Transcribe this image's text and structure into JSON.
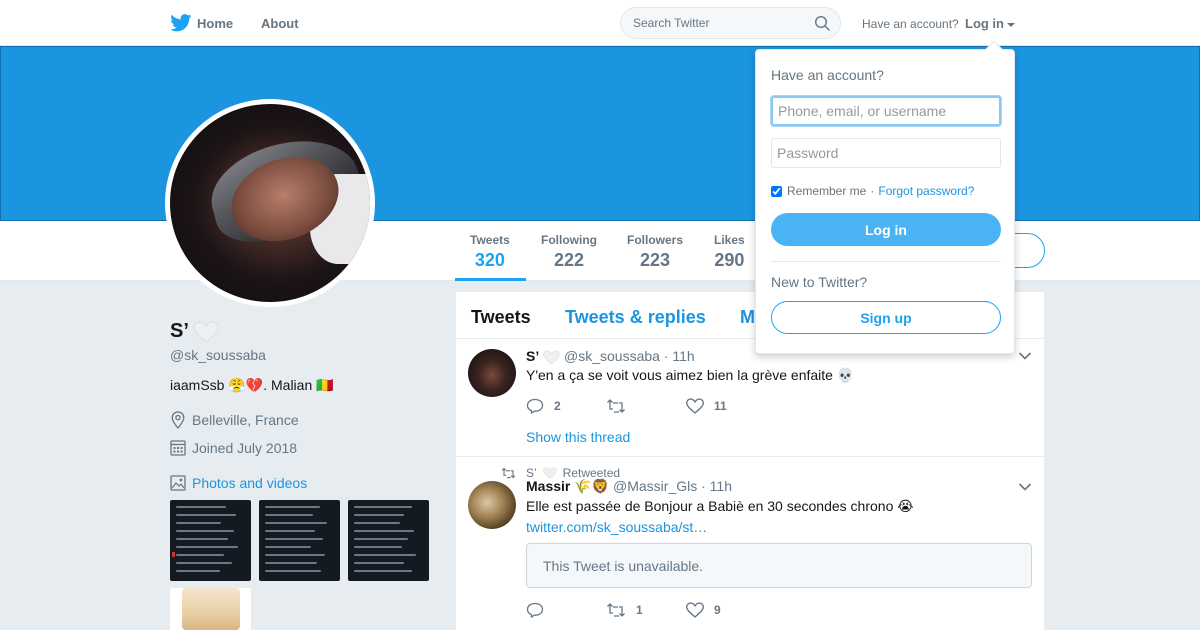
{
  "nav": {
    "home_label": "Home",
    "about_label": "About",
    "search_placeholder": "Search Twitter",
    "have_account_text": "Have an account?",
    "login_label": "Log in"
  },
  "colors": {
    "brand_blue": "#1da1f2",
    "banner_blue": "#1b95e0",
    "link_blue": "#1b95e0"
  },
  "profile_nav": {
    "stats": [
      {
        "label": "Tweets",
        "value": "320"
      },
      {
        "label": "Following",
        "value": "222"
      },
      {
        "label": "Followers",
        "value": "223"
      },
      {
        "label": "Likes",
        "value": "290"
      }
    ],
    "active_stat": "Tweets"
  },
  "profile": {
    "name": "S’",
    "handle": "@sk_soussaba",
    "bio": "iaamSsb 😤💔. Malian 🇲🇱",
    "location": "Belleville, France",
    "joined": "Joined July 2018",
    "photos_link": "Photos and videos"
  },
  "timeline": {
    "tabs": [
      "Tweets",
      "Tweets & replies",
      "M"
    ],
    "tweets": [
      {
        "name": "S’",
        "handle": "@sk_soussaba",
        "time": "· 11h",
        "text": "Y'en a ça se voit vous aimez bien la grève enfaite 💀",
        "replies": "2",
        "retweets": "",
        "likes": "11",
        "thread_link": "Show this thread"
      },
      {
        "retweeted_by": "S’",
        "retweeted_label": "Retweeted",
        "name": "Massir 🌾🦁",
        "handle": "@Massir_Gls",
        "time": "· 11h",
        "text": "Elle est passée de Bonjour a Babiè en 30 secondes chrono 😭",
        "link": "twitter.com/sk_soussaba/st…",
        "quote_unavailable": "This Tweet is unavailable.",
        "replies": "",
        "retweets": "1",
        "likes": "9"
      }
    ]
  },
  "login_dropdown": {
    "title": "Have an account?",
    "username_placeholder": "Phone, email, or username",
    "password_placeholder": "Password",
    "remember_label": "Remember me",
    "remember_checked": true,
    "separator": "·",
    "forgot_label": "Forgot password?",
    "login_button": "Log in",
    "new_to_twitter": "New to Twitter?",
    "signup_button": "Sign up"
  },
  "icons": [
    "twitter-bird-icon",
    "search-icon",
    "caret-down-icon",
    "location-icon",
    "calendar-icon",
    "photo-icon",
    "reply-icon",
    "retweet-icon",
    "like-icon",
    "chevron-down-icon",
    "heart-icon"
  ]
}
